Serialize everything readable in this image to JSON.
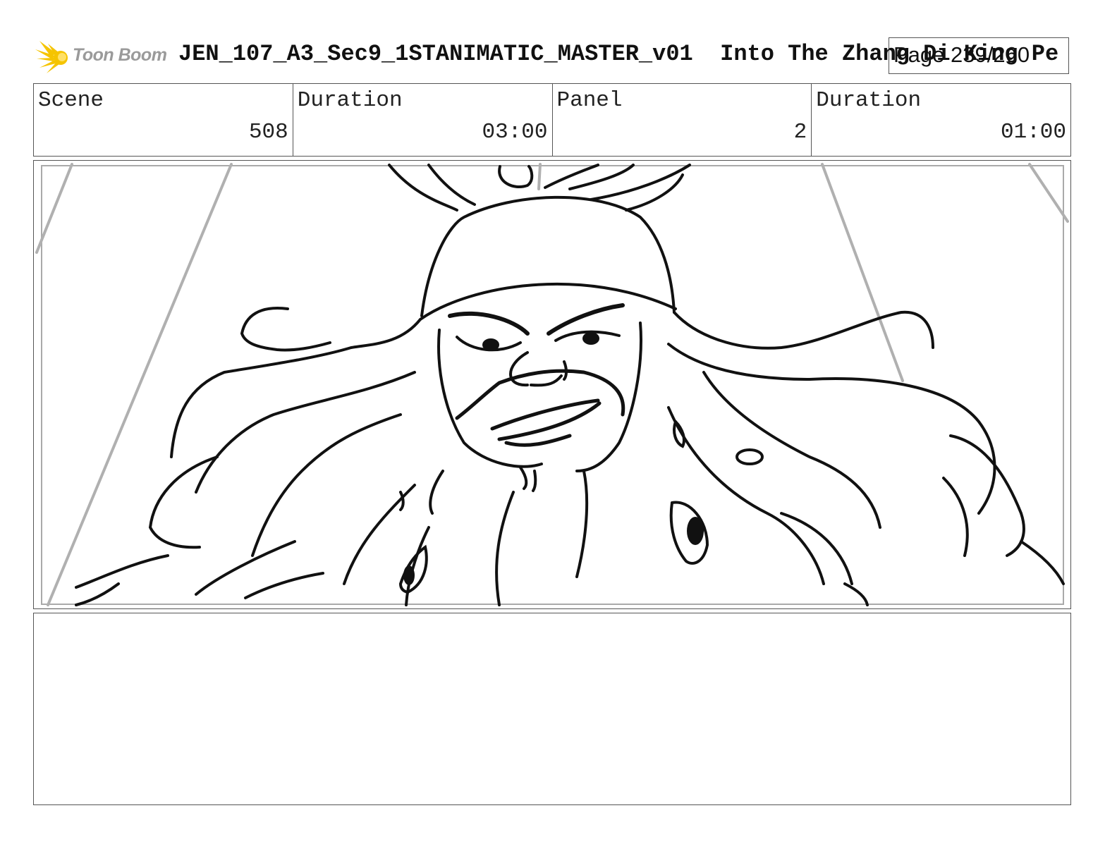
{
  "header": {
    "logo_text": "Toon Boom",
    "title": "JEN_107_A3_Sec9_1STANIMATIC_MASTER_v01  Into The Zhang Di King Pe",
    "page": "Page 239/260"
  },
  "info": {
    "scene_label": "Scene",
    "scene_value": "508",
    "duration_label": "Duration",
    "duration_value": "03:00",
    "panel_label": "Panel",
    "panel_value": "2",
    "panel_duration_label": "Duration",
    "panel_duration_value": "01:00"
  },
  "colors": {
    "logo_accent": "#f5c400",
    "logo_text": "#9a9a9a",
    "border": "#555555",
    "ink": "#111111"
  },
  "icons": {
    "logo": "toon-boom-sunburst-icon"
  }
}
